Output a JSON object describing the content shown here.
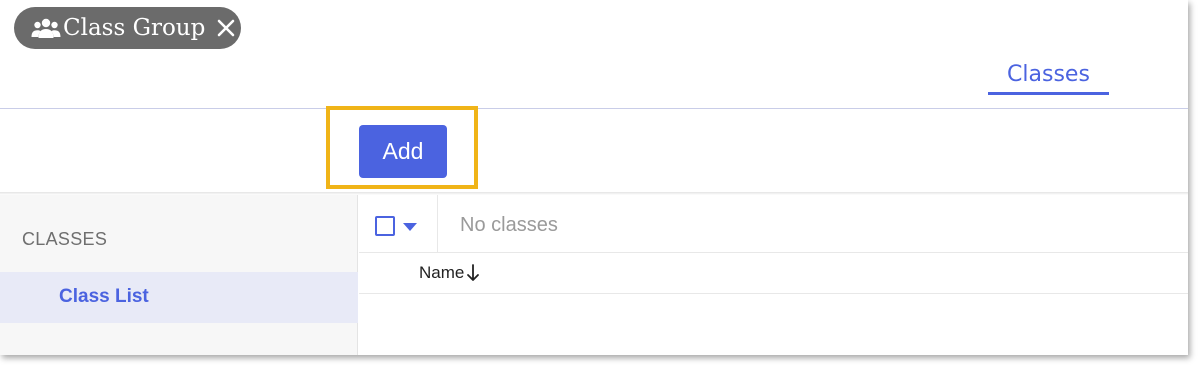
{
  "chip": {
    "label": "Class Group",
    "icon": "users-icon",
    "close_icon": "close-icon"
  },
  "tabs": [
    {
      "label": "Classes",
      "active": true
    }
  ],
  "toolbar": {
    "add_label": "Add"
  },
  "sidebar": {
    "heading": "CLASSES",
    "items": [
      {
        "label": "Class List",
        "active": true
      }
    ]
  },
  "list": {
    "empty_text": "No classes",
    "columns": [
      {
        "label": "Name",
        "sort": "descending"
      }
    ]
  },
  "colors": {
    "accent": "#4b63e0",
    "highlight": "#f0b418",
    "chip_bg": "#6b6b6b"
  }
}
